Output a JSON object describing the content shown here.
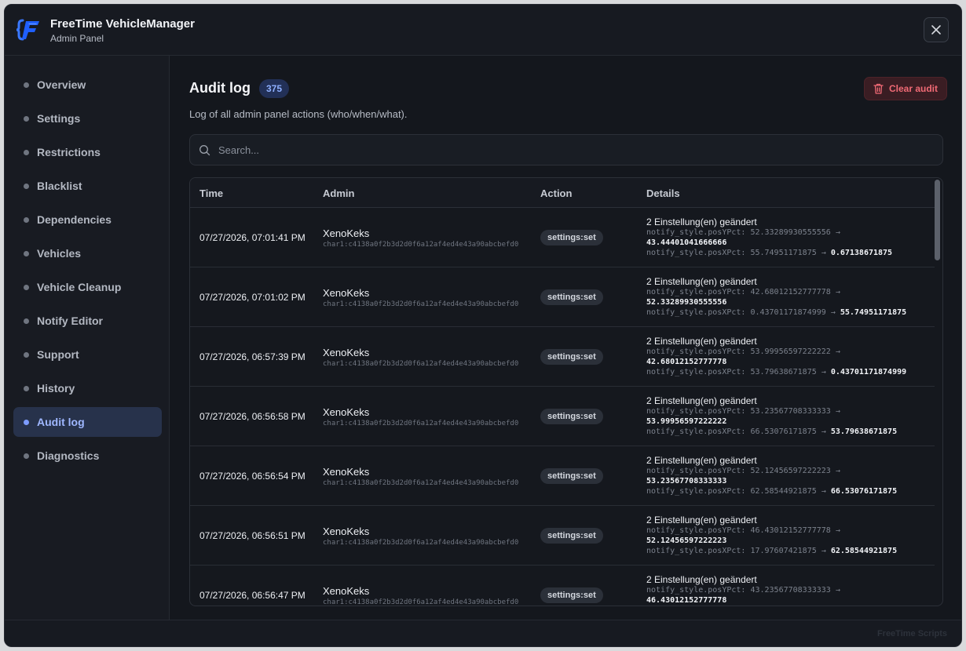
{
  "app": {
    "title": "FreeTime VehicleManager",
    "subtitle": "Admin Panel",
    "brand_colors": {
      "accent": "#7d9cff",
      "danger": "#f06a75",
      "logo": "#3a78ff"
    }
  },
  "sidebar": {
    "items": [
      {
        "label": "Overview",
        "active": false
      },
      {
        "label": "Settings",
        "active": false
      },
      {
        "label": "Restrictions",
        "active": false
      },
      {
        "label": "Blacklist",
        "active": false
      },
      {
        "label": "Dependencies",
        "active": false
      },
      {
        "label": "Vehicles",
        "active": false
      },
      {
        "label": "Vehicle Cleanup",
        "active": false
      },
      {
        "label": "Notify Editor",
        "active": false
      },
      {
        "label": "Support",
        "active": false
      },
      {
        "label": "History",
        "active": false
      },
      {
        "label": "Audit log",
        "active": true
      },
      {
        "label": "Diagnostics",
        "active": false
      }
    ]
  },
  "page": {
    "title": "Audit log",
    "count": "375",
    "clear_label": "Clear audit",
    "subtitle": "Log of all admin panel actions (who/when/what).",
    "search_placeholder": "Search..."
  },
  "table": {
    "columns": [
      "Time",
      "Admin",
      "Action",
      "Details"
    ],
    "rows": [
      {
        "time": "07/27/2026, 07:01:41 PM",
        "admin": "XenoKeks",
        "admin_id": "char1:c4138a0f2b3d2d0f6a12af4ed4e43a90abcbefd0",
        "action": "settings:set",
        "details_title": "2 Einstellung(en) geändert",
        "line1_old": "notify_style.posYPct: 52.33289930555556 →",
        "line1_new": "43.44401041666666",
        "line2_old": "notify_style.posXPct: 55.74951171875 →",
        "line2_new": "0.67138671875"
      },
      {
        "time": "07/27/2026, 07:01:02 PM",
        "admin": "XenoKeks",
        "admin_id": "char1:c4138a0f2b3d2d0f6a12af4ed4e43a90abcbefd0",
        "action": "settings:set",
        "details_title": "2 Einstellung(en) geändert",
        "line1_old": "notify_style.posYPct: 42.68012152777778 →",
        "line1_new": "52.33289930555556",
        "line2_old": "notify_style.posXPct: 0.43701171874999 →",
        "line2_new": "55.74951171875"
      },
      {
        "time": "07/27/2026, 06:57:39 PM",
        "admin": "XenoKeks",
        "admin_id": "char1:c4138a0f2b3d2d0f6a12af4ed4e43a90abcbefd0",
        "action": "settings:set",
        "details_title": "2 Einstellung(en) geändert",
        "line1_old": "notify_style.posYPct: 53.99956597222222 →",
        "line1_new": "42.68012152777778",
        "line2_old": "notify_style.posXPct: 53.79638671875 →",
        "line2_new": "0.43701171874999"
      },
      {
        "time": "07/27/2026, 06:56:58 PM",
        "admin": "XenoKeks",
        "admin_id": "char1:c4138a0f2b3d2d0f6a12af4ed4e43a90abcbefd0",
        "action": "settings:set",
        "details_title": "2 Einstellung(en) geändert",
        "line1_old": "notify_style.posYPct: 53.23567708333333 →",
        "line1_new": "53.99956597222222",
        "line2_old": "notify_style.posXPct: 66.53076171875 →",
        "line2_new": "53.79638671875"
      },
      {
        "time": "07/27/2026, 06:56:54 PM",
        "admin": "XenoKeks",
        "admin_id": "char1:c4138a0f2b3d2d0f6a12af4ed4e43a90abcbefd0",
        "action": "settings:set",
        "details_title": "2 Einstellung(en) geändert",
        "line1_old": "notify_style.posYPct: 52.12456597222223 →",
        "line1_new": "53.23567708333333",
        "line2_old": "notify_style.posXPct: 62.58544921875 →",
        "line2_new": "66.53076171875"
      },
      {
        "time": "07/27/2026, 06:56:51 PM",
        "admin": "XenoKeks",
        "admin_id": "char1:c4138a0f2b3d2d0f6a12af4ed4e43a90abcbefd0",
        "action": "settings:set",
        "details_title": "2 Einstellung(en) geändert",
        "line1_old": "notify_style.posYPct: 46.43012152777778 →",
        "line1_new": "52.12456597222223",
        "line2_old": "notify_style.posXPct: 17.97607421875 →",
        "line2_new": "62.58544921875"
      },
      {
        "time": "07/27/2026, 06:56:47 PM",
        "admin": "XenoKeks",
        "admin_id": "char1:c4138a0f2b3d2d0f6a12af4ed4e43a90abcbefd0",
        "action": "settings:set",
        "details_title": "2 Einstellung(en) geändert",
        "line1_old": "notify_style.posYPct: 43.23567708333333 →",
        "line1_new": "46.43012152777778",
        "line2_old": "",
        "line2_new": ""
      }
    ]
  },
  "footer": {
    "brand": "FreeTime Scripts"
  },
  "icons": {
    "close": "close-icon",
    "search": "search-icon",
    "trash": "trash-icon",
    "logo": "logo-icon"
  }
}
